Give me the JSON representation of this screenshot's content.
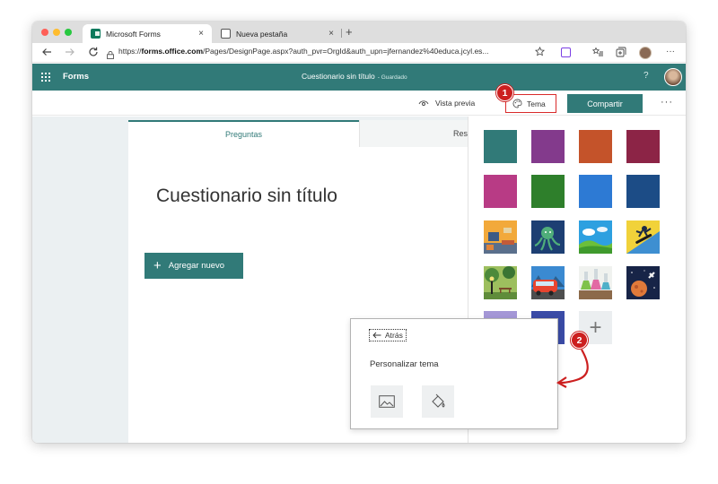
{
  "browser": {
    "tabs": [
      {
        "title": "Microsoft Forms",
        "close": "×"
      },
      {
        "title": "Nueva pestaña",
        "close": "×"
      }
    ],
    "new_tab": "+",
    "url_prefix": "https://",
    "url_domain": "forms.office.com",
    "url_rest": "/Pages/DesignPage.aspx?auth_pvr=OrgId&auth_upn=jfernandez%40educa.jcyl.es...",
    "menu": "···"
  },
  "app": {
    "brand": "Forms",
    "doc_title": "Cuestionario sin título",
    "save_state": "- Guardado",
    "help": "?"
  },
  "commands": {
    "preview": "Vista previa",
    "theme": "Tema",
    "share": "Compartir",
    "more": "···"
  },
  "form": {
    "tab_questions": "Preguntas",
    "tab_responses": "Respuestas",
    "title": "Cuestionario sin título",
    "add_new": "Agregar nuevo"
  },
  "theme_panel": {
    "solid_colors": [
      "#317a78",
      "#833a8c",
      "#c4532a",
      "#8c2446",
      "#b83b85",
      "#2e7f2b",
      "#2d7ad4",
      "#1c4c86"
    ],
    "image_themes": [
      "interior-theme",
      "octopus-theme",
      "landscape-theme",
      "snowboard-theme",
      "park-theme",
      "bus-theme",
      "lab-theme",
      "space-theme"
    ],
    "add_label": "+"
  },
  "popup": {
    "back": "Atrás",
    "title": "Personalizar tema",
    "options": [
      "image-icon",
      "paint-bucket-icon"
    ]
  },
  "badges": [
    "1",
    "2"
  ],
  "colors": {
    "accent": "#317a78",
    "badge": "#cc1f1f"
  }
}
